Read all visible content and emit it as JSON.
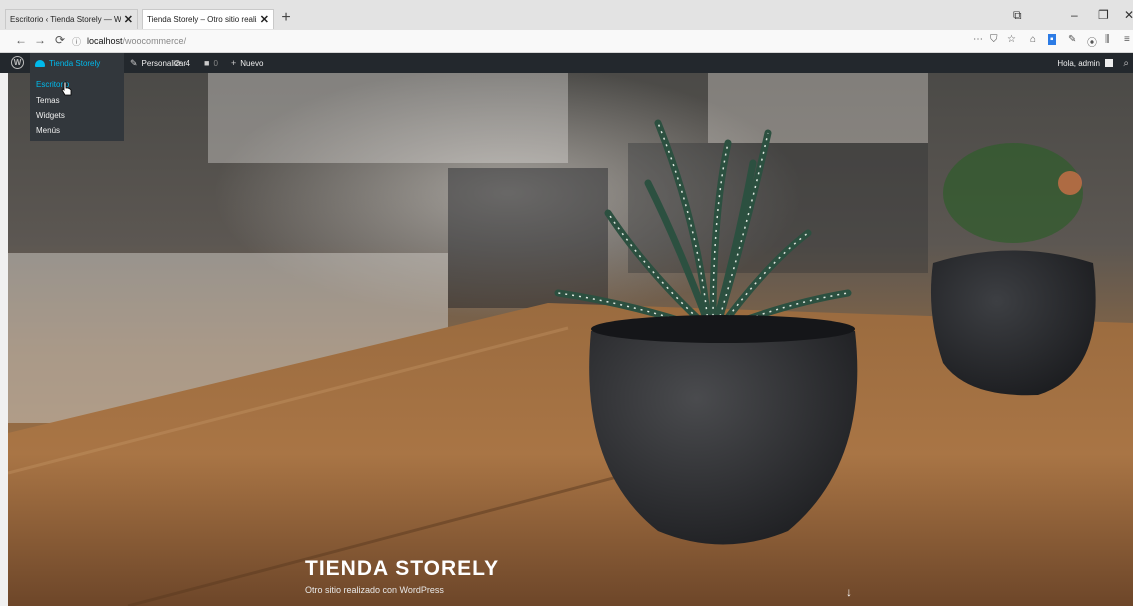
{
  "browser": {
    "tabs": [
      {
        "title": "Escritorio ‹ Tienda Storely — Word",
        "active": false
      },
      {
        "title": "Tienda Storely – Otro sitio realizado",
        "active": true
      }
    ],
    "url_host": "localhost",
    "url_path": "/woocommerce/",
    "new_tab_symbol": "+"
  },
  "admin_bar": {
    "site_name": "Tienda Storely",
    "customize": "Personalizar",
    "updates_count": "4",
    "comments_count": "0",
    "new": "Nuevo",
    "howdy": "Hola, admin"
  },
  "submenu": {
    "items": [
      "Escritorio",
      "Temas",
      "Widgets",
      "Menús"
    ],
    "highlighted_index": 0
  },
  "hero": {
    "title": "TIENDA STORELY",
    "tagline": "Otro sitio realizado con WordPress",
    "scroll_arrow": "↓"
  },
  "colors": {
    "admin_bar": "#23282d",
    "accent": "#00b9eb"
  }
}
